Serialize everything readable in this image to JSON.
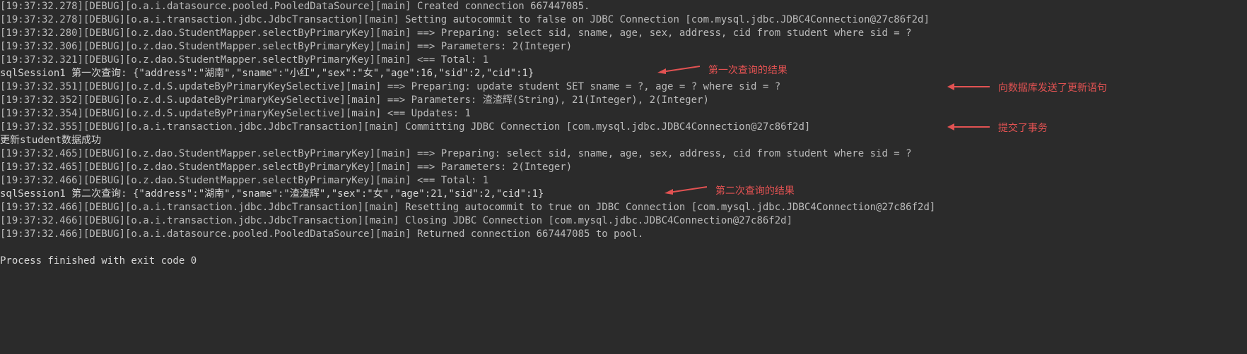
{
  "lines": {
    "l1": "[19:37:32.278][DEBUG][o.a.i.datasource.pooled.PooledDataSource][main] Created connection 667447085.",
    "l2": "[19:37:32.278][DEBUG][o.a.i.transaction.jdbc.JdbcTransaction][main] Setting autocommit to false on JDBC Connection [com.mysql.jdbc.JDBC4Connection@27c86f2d]",
    "l3": "[19:37:32.280][DEBUG][o.z.dao.StudentMapper.selectByPrimaryKey][main] ==>  Preparing: select sid, sname, age, sex, address, cid from student where sid = ?",
    "l4": "[19:37:32.306][DEBUG][o.z.dao.StudentMapper.selectByPrimaryKey][main] ==> Parameters: 2(Integer)",
    "l5": "[19:37:32.321][DEBUG][o.z.dao.StudentMapper.selectByPrimaryKey][main] <==      Total: 1",
    "l6": "sqlSession1 第一次查询: {\"address\":\"湖南\",\"sname\":\"小红\",\"sex\":\"女\",\"age\":16,\"sid\":2,\"cid\":1}",
    "l7": "[19:37:32.351][DEBUG][o.z.d.S.updateByPrimaryKeySelective][main] ==>  Preparing: update student SET sname = ?, age = ? where sid = ?",
    "l8": "[19:37:32.352][DEBUG][o.z.d.S.updateByPrimaryKeySelective][main] ==> Parameters: 渣渣辉(String), 21(Integer), 2(Integer)",
    "l9": "[19:37:32.354][DEBUG][o.z.d.S.updateByPrimaryKeySelective][main] <==    Updates: 1",
    "l10": "[19:37:32.355][DEBUG][o.a.i.transaction.jdbc.JdbcTransaction][main] Committing JDBC Connection [com.mysql.jdbc.JDBC4Connection@27c86f2d]",
    "l11": "更新student数据成功",
    "l12": "[19:37:32.465][DEBUG][o.z.dao.StudentMapper.selectByPrimaryKey][main] ==>  Preparing: select sid, sname, age, sex, address, cid from student where sid = ?",
    "l13": "[19:37:32.465][DEBUG][o.z.dao.StudentMapper.selectByPrimaryKey][main] ==> Parameters: 2(Integer)",
    "l14": "[19:37:32.466][DEBUG][o.z.dao.StudentMapper.selectByPrimaryKey][main] <==      Total: 1",
    "l15": "sqlSession1 第二次查询: {\"address\":\"湖南\",\"sname\":\"渣渣辉\",\"sex\":\"女\",\"age\":21,\"sid\":2,\"cid\":1}",
    "l16": "[19:37:32.466][DEBUG][o.a.i.transaction.jdbc.JdbcTransaction][main] Resetting autocommit to true on JDBC Connection [com.mysql.jdbc.JDBC4Connection@27c86f2d]",
    "l17": "[19:37:32.466][DEBUG][o.a.i.transaction.jdbc.JdbcTransaction][main] Closing JDBC Connection [com.mysql.jdbc.JDBC4Connection@27c86f2d]",
    "l18": "[19:37:32.466][DEBUG][o.a.i.datasource.pooled.PooledDataSource][main] Returned connection 667447085 to pool.",
    "l19": "Process finished with exit code 0"
  },
  "annotations": {
    "a1": "第一次查询的结果",
    "a2": "向数据库发送了更新语句",
    "a3": "提交了事务",
    "a4": "第二次查询的结果"
  }
}
